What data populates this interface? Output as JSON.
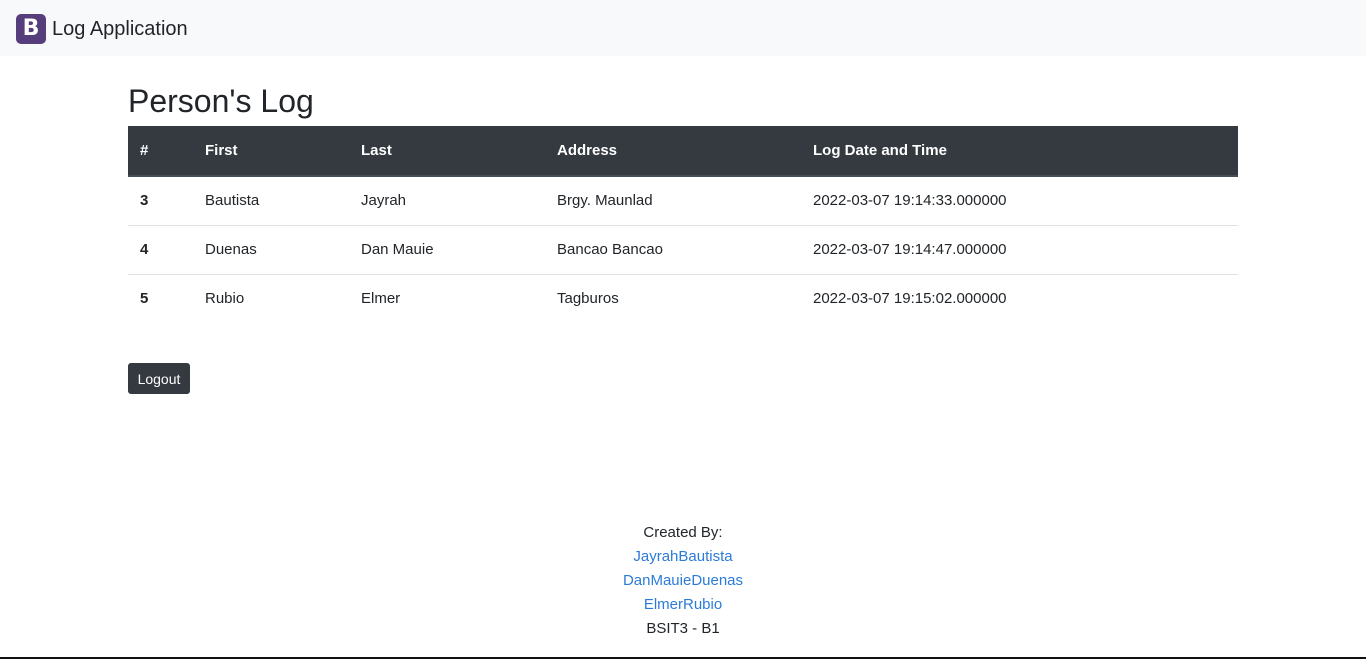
{
  "navbar": {
    "logo_letter": "B",
    "brand_text": "Log Application",
    "logo_color": "#563d7c"
  },
  "page": {
    "title": "Person's Log"
  },
  "table": {
    "headers": {
      "num": "#",
      "first": "First",
      "last": "Last",
      "address": "Address",
      "log": "Log Date and Time"
    },
    "rows": [
      {
        "num": "3",
        "first": "Bautista",
        "last": "Jayrah",
        "address": "Brgy. Maunlad",
        "log": "2022-03-07 19:14:33.000000"
      },
      {
        "num": "4",
        "first": "Duenas",
        "last": "Dan Mauie",
        "address": "Bancao Bancao",
        "log": "2022-03-07 19:14:47.000000"
      },
      {
        "num": "5",
        "first": "Rubio",
        "last": "Elmer",
        "address": "Tagburos",
        "log": "2022-03-07 19:15:02.000000"
      }
    ]
  },
  "actions": {
    "logout_label": "Logout"
  },
  "footer": {
    "created_by": "Created By:",
    "authors": [
      "JayrahBautista",
      "DanMauieDuenas",
      "ElmerRubio"
    ],
    "section": "BSIT3 - B1"
  },
  "colors": {
    "dark": "#343a40",
    "link": "#2b7bd8"
  }
}
